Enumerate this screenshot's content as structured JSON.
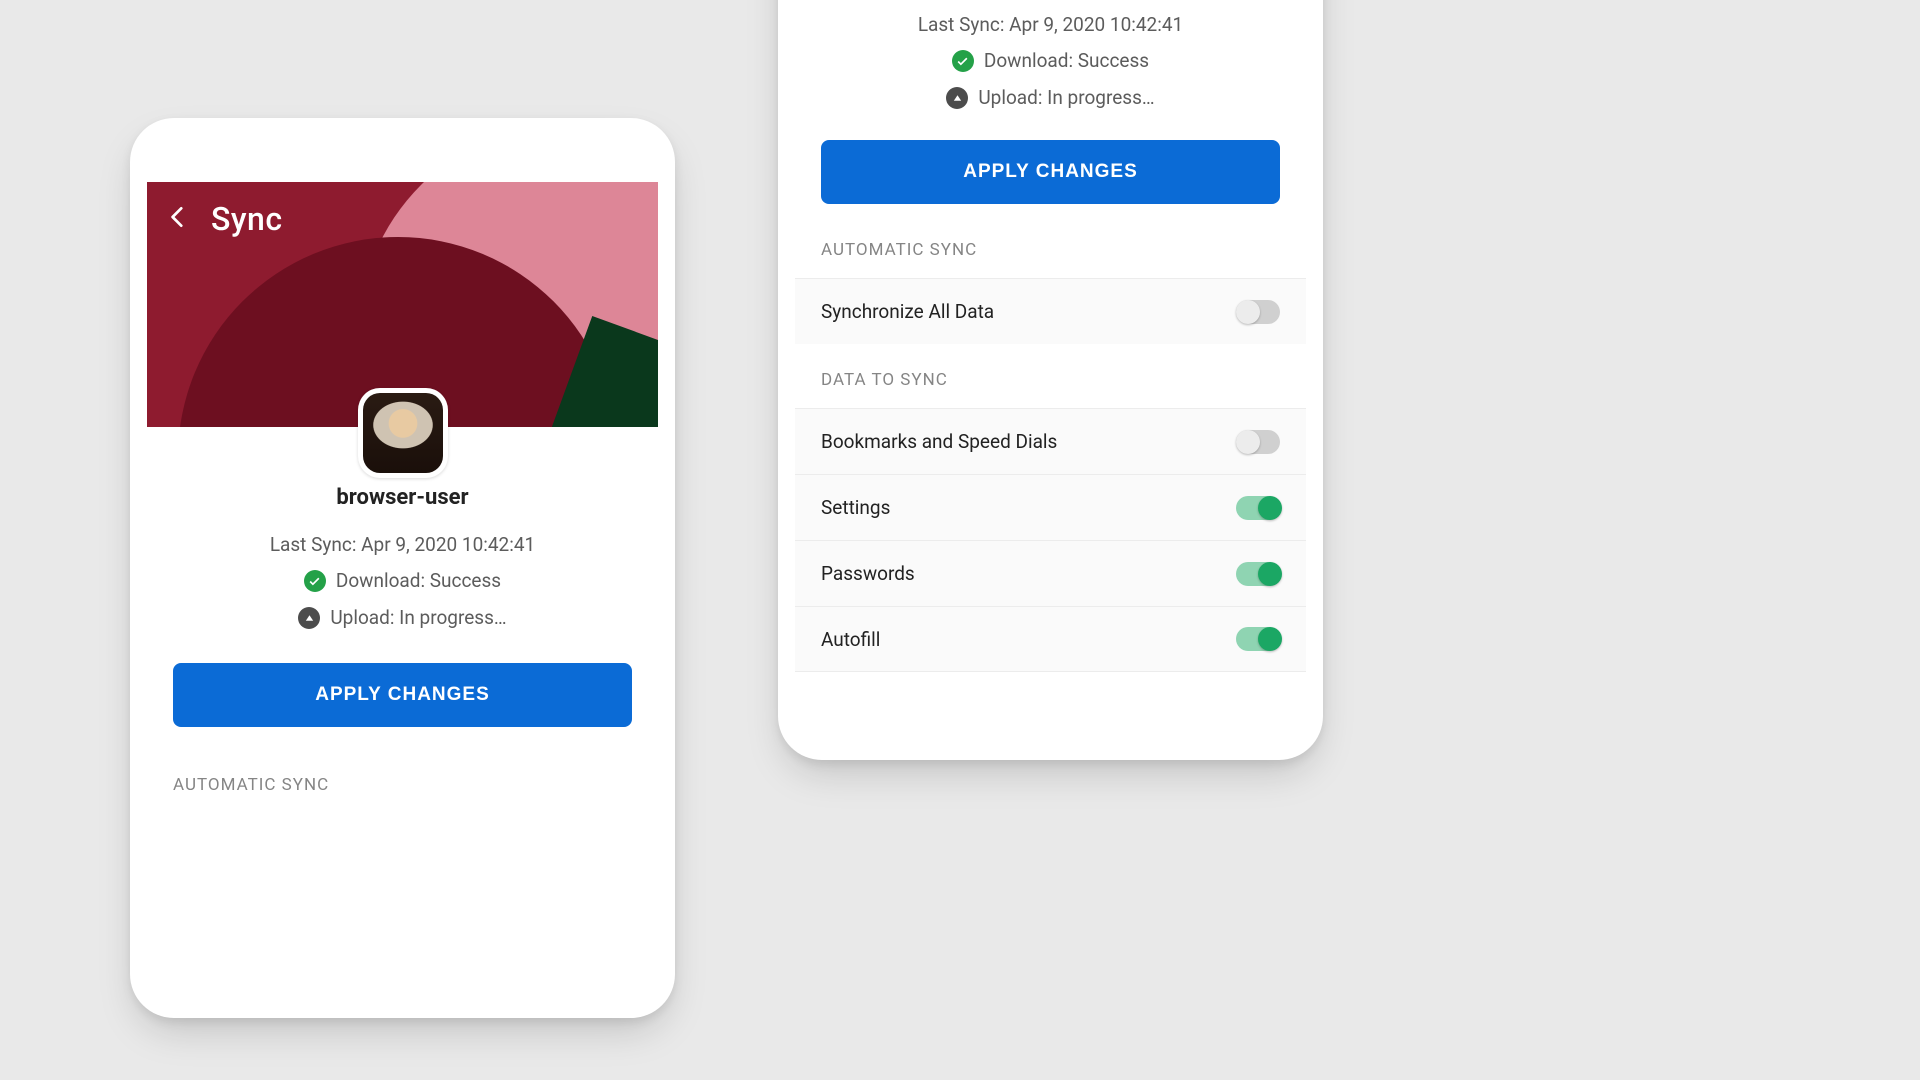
{
  "left": {
    "title": "Sync",
    "username": "browser-user",
    "last_sync_label": "Last Sync: Apr 9, 2020 10:42:41",
    "download_label": "Download: Success",
    "upload_label": "Upload: In progress…",
    "apply_label": "APPLY CHANGES",
    "section_auto": "AUTOMATIC SYNC"
  },
  "right": {
    "last_sync_label": "Last Sync: Apr 9, 2020 10:42:41",
    "download_label": "Download: Success",
    "upload_label": "Upload: In progress…",
    "apply_label": "APPLY CHANGES",
    "section_auto": "AUTOMATIC SYNC",
    "section_data": "DATA TO SYNC",
    "rows": [
      {
        "label": "Synchronize All Data",
        "on": false
      },
      {
        "label": "Bookmarks and Speed Dials",
        "on": false
      },
      {
        "label": "Settings",
        "on": true
      },
      {
        "label": "Passwords",
        "on": true
      },
      {
        "label": "Autofill",
        "on": true
      }
    ]
  }
}
